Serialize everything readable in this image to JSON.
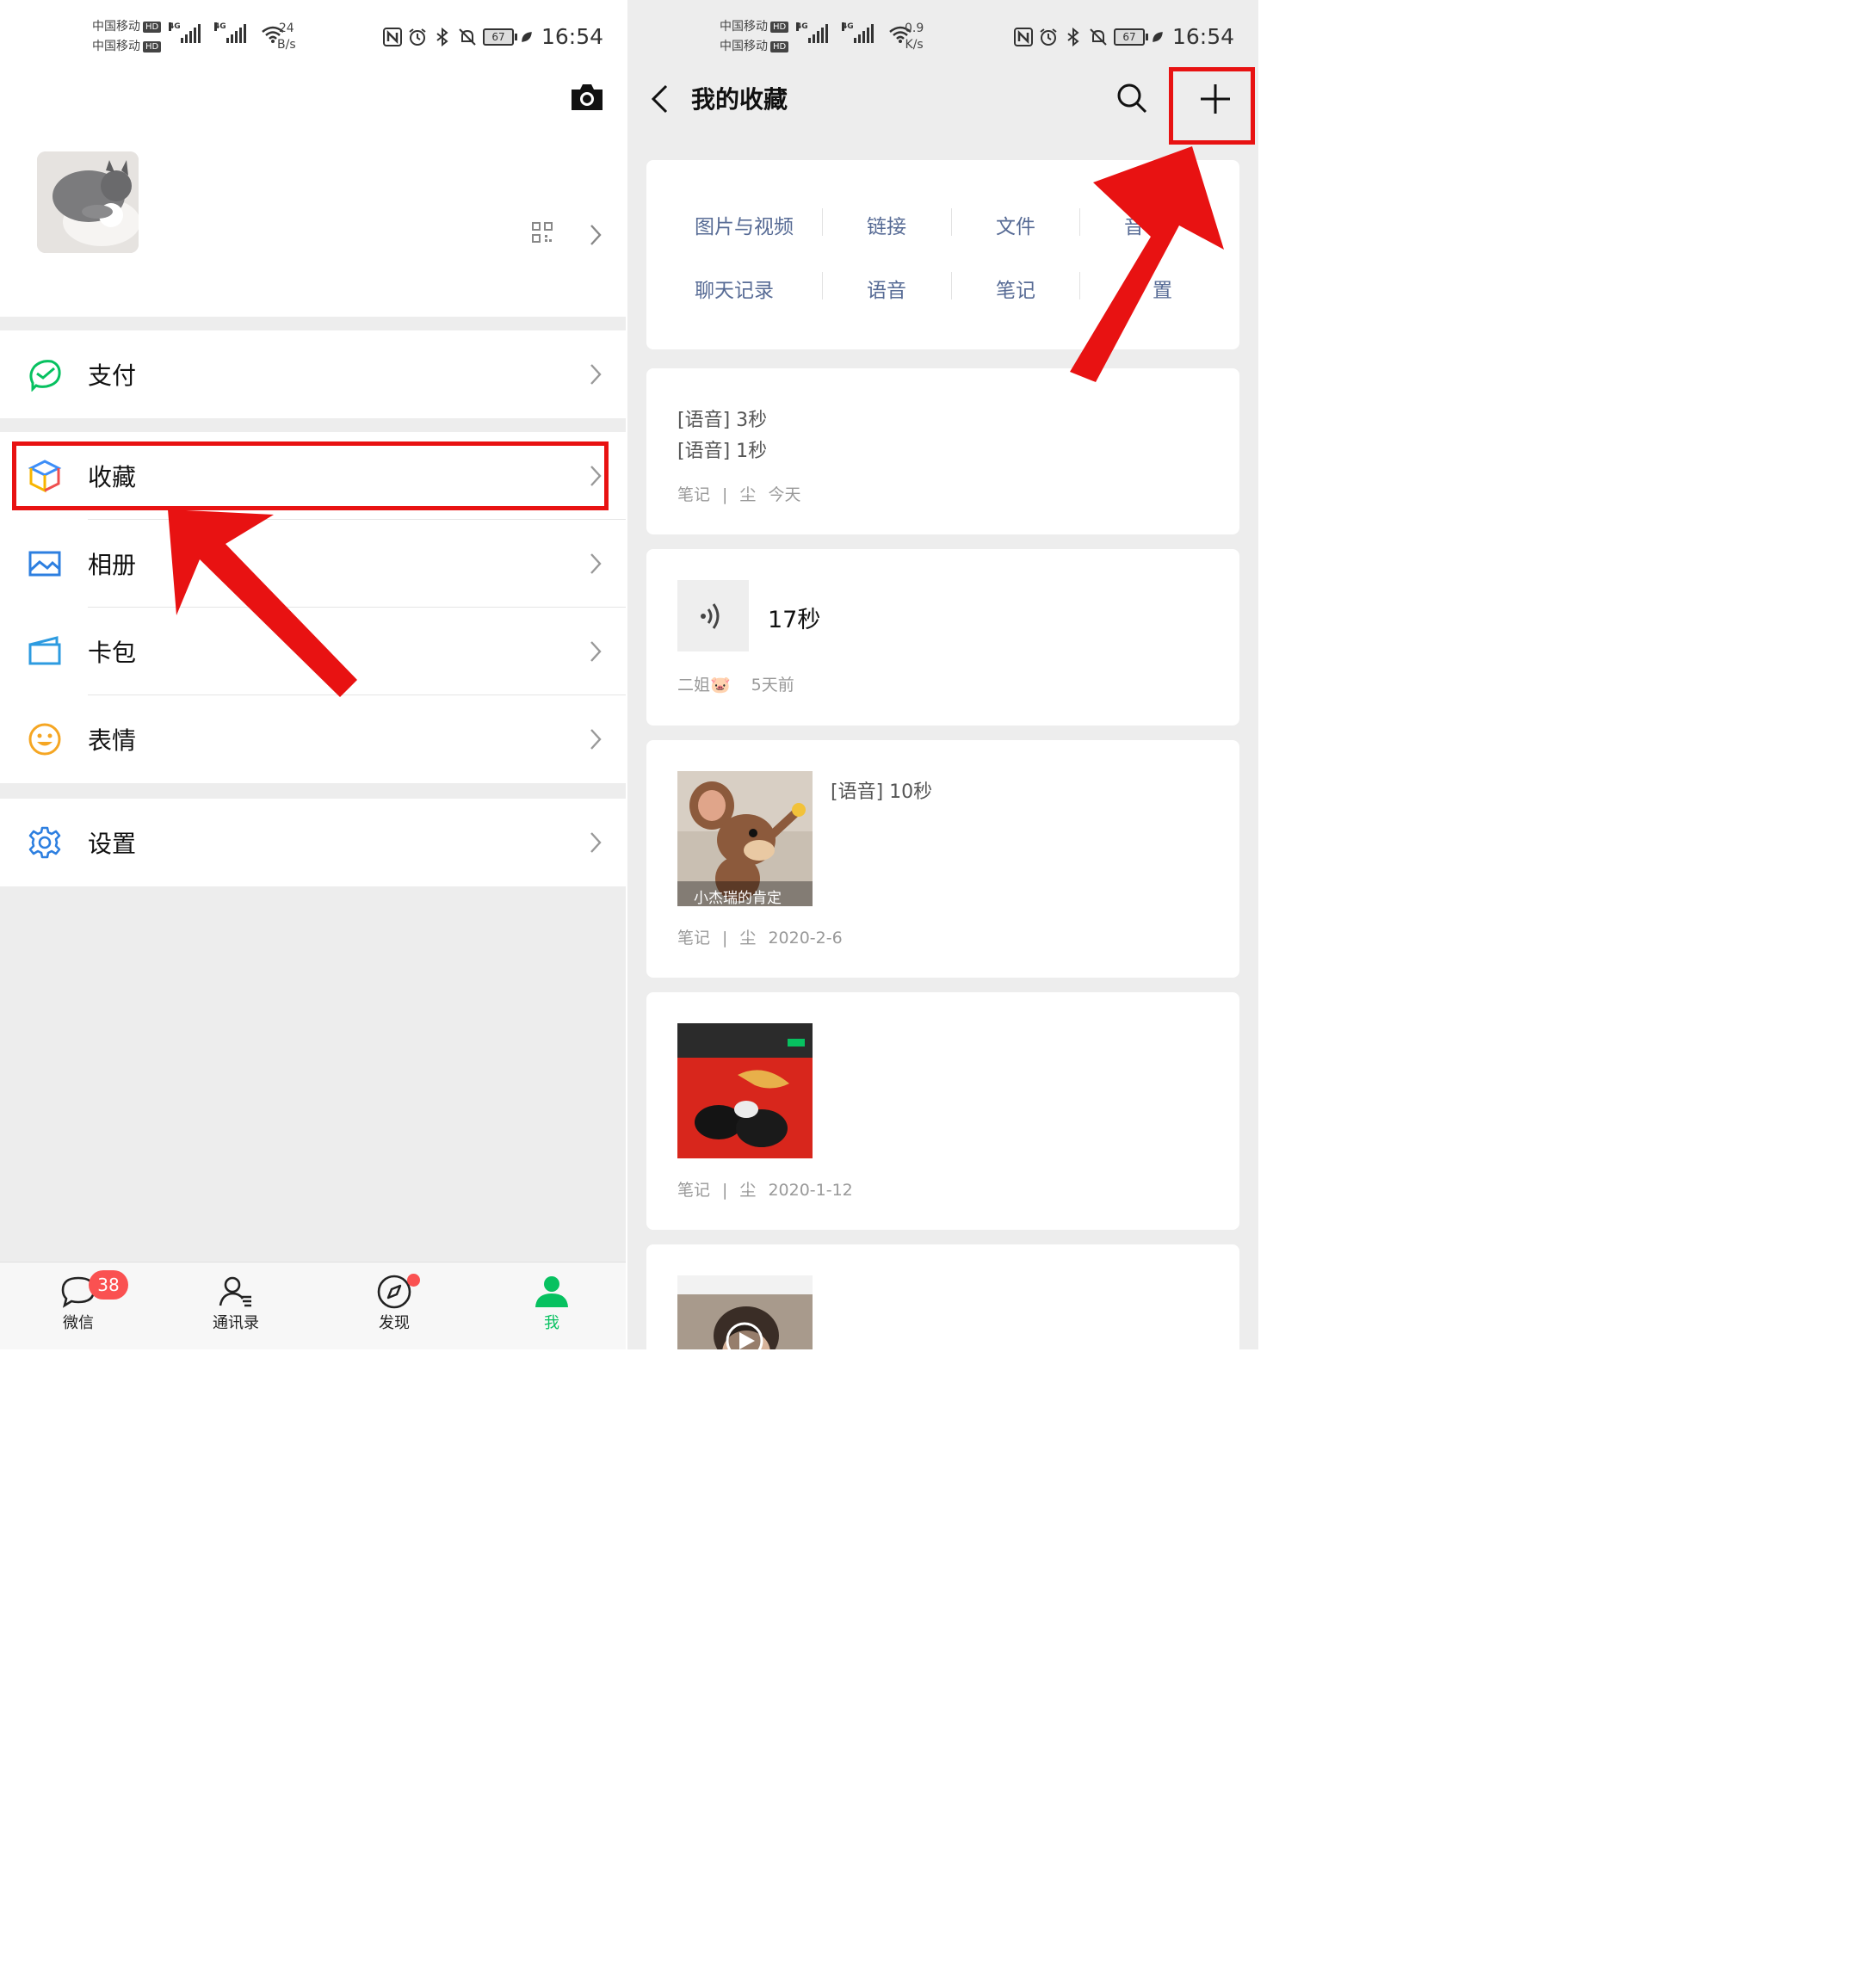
{
  "left": {
    "status": {
      "carrier1": "中国移动",
      "carrier2": "中国移动",
      "hd": "HD",
      "net1": "4G",
      "net2": "4G",
      "speed_value": "24",
      "speed_unit": "B/s",
      "battery": "67",
      "time": "16:54"
    },
    "menu": {
      "pay": "支付",
      "favorites": "收藏",
      "album": "相册",
      "cards": "卡包",
      "stickers": "表情",
      "settings": "设置"
    },
    "tabbar": {
      "chats": "微信",
      "chats_badge": "38",
      "contacts": "通讯录",
      "discover": "发现",
      "me": "我"
    }
  },
  "right": {
    "status": {
      "carrier1": "中国移动",
      "carrier2": "中国移动",
      "hd": "HD",
      "net1": "4G",
      "net2": "4G",
      "speed_value": "0.9",
      "speed_unit": "K/s",
      "battery": "67",
      "time": "16:54"
    },
    "nav": {
      "title": "我的收藏"
    },
    "categories": {
      "row1": [
        "图片与视频",
        "链接",
        "文件",
        "音"
      ],
      "row2": [
        "聊天记录",
        "语音",
        "笔记",
        "置"
      ]
    },
    "items": [
      {
        "lines": [
          "[语音] 3秒",
          "[语音] 1秒"
        ],
        "tag": "笔记",
        "sep": "|",
        "source": "尘",
        "date": "今天"
      },
      {
        "duration": "17秒",
        "source": "二姐🐷",
        "date": "5天前"
      },
      {
        "line": "[语音] 10秒",
        "image_caption": "小杰瑞的肯定",
        "tag": "笔记",
        "sep": "|",
        "source": "尘",
        "date": "2020-2-6"
      },
      {
        "tag": "笔记",
        "sep": "|",
        "source": "尘",
        "date": "2020-1-12"
      }
    ]
  },
  "colors": {
    "accent_green": "#07c160",
    "link_blue": "#576b95",
    "annotation_red": "#e81212"
  }
}
